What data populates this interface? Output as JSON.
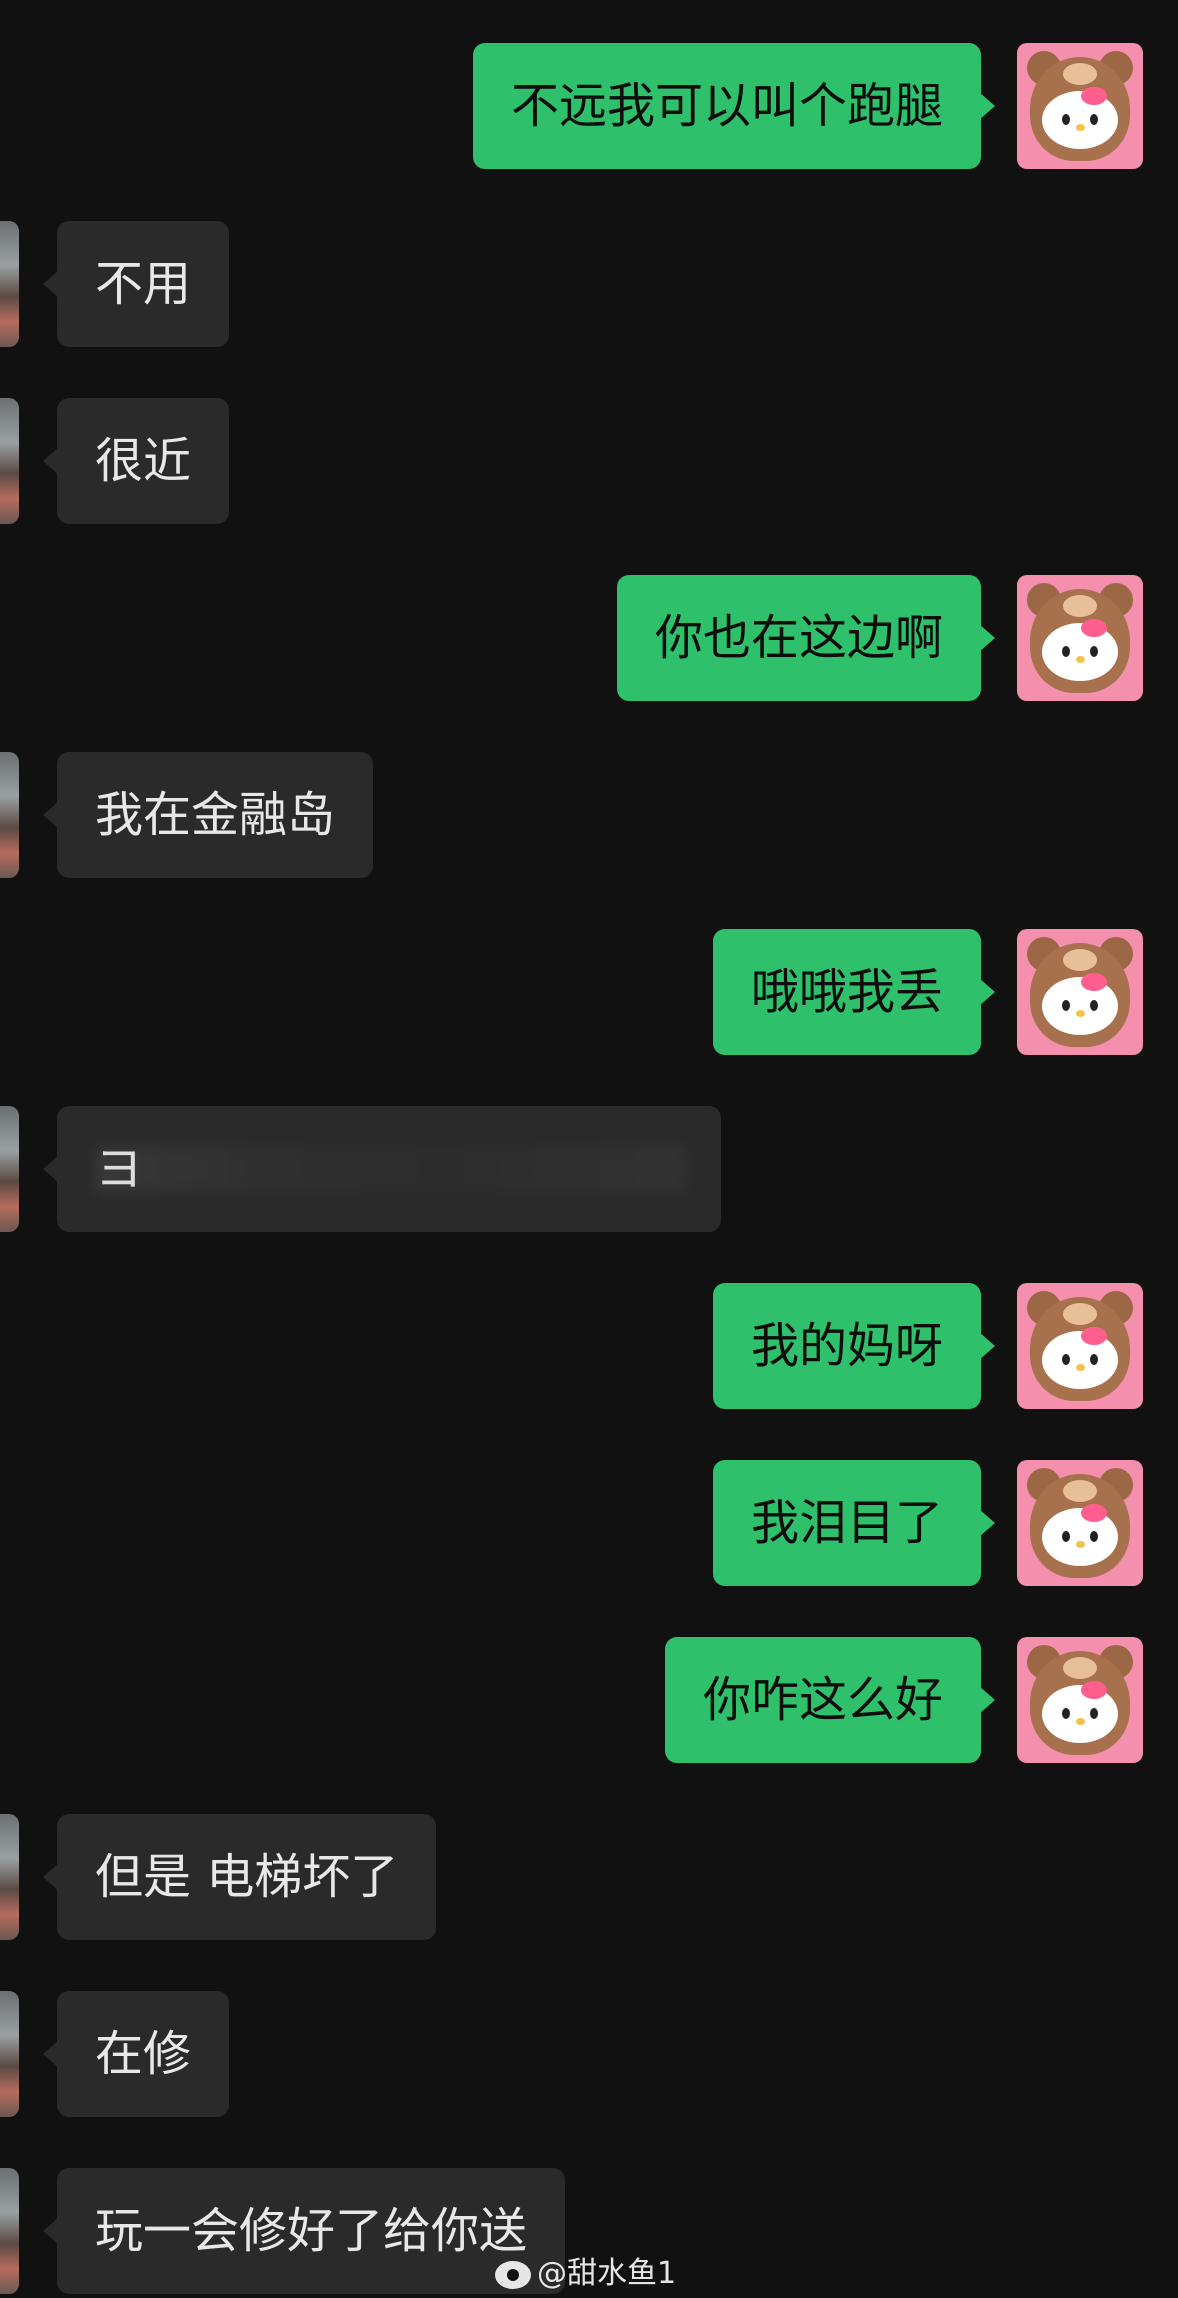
{
  "messages": [
    {
      "from": "me",
      "text": "不远我可以叫个跑腿"
    },
    {
      "from": "other",
      "text": "不用"
    },
    {
      "from": "other",
      "text": "很近"
    },
    {
      "from": "me",
      "text": "你也在这边啊"
    },
    {
      "from": "other",
      "text": "我在金融岛"
    },
    {
      "from": "me",
      "text": "哦哦我丢"
    },
    {
      "from": "other",
      "text": "",
      "redacted": true
    },
    {
      "from": "me",
      "text": "我的妈呀"
    },
    {
      "from": "me",
      "text": "我泪目了"
    },
    {
      "from": "me",
      "text": "你咋这么好"
    },
    {
      "from": "other",
      "text": "但是 电梯坏了"
    },
    {
      "from": "other",
      "text": "在修"
    },
    {
      "from": "other",
      "text": "玩一会修好了给你送"
    }
  ],
  "watermark": {
    "text": "@甜水鱼1",
    "icon": "weibo-icon"
  },
  "colors": {
    "background": "#111111",
    "me_bubble": "#2ec06a",
    "other_bubble": "#2a2a2a"
  }
}
